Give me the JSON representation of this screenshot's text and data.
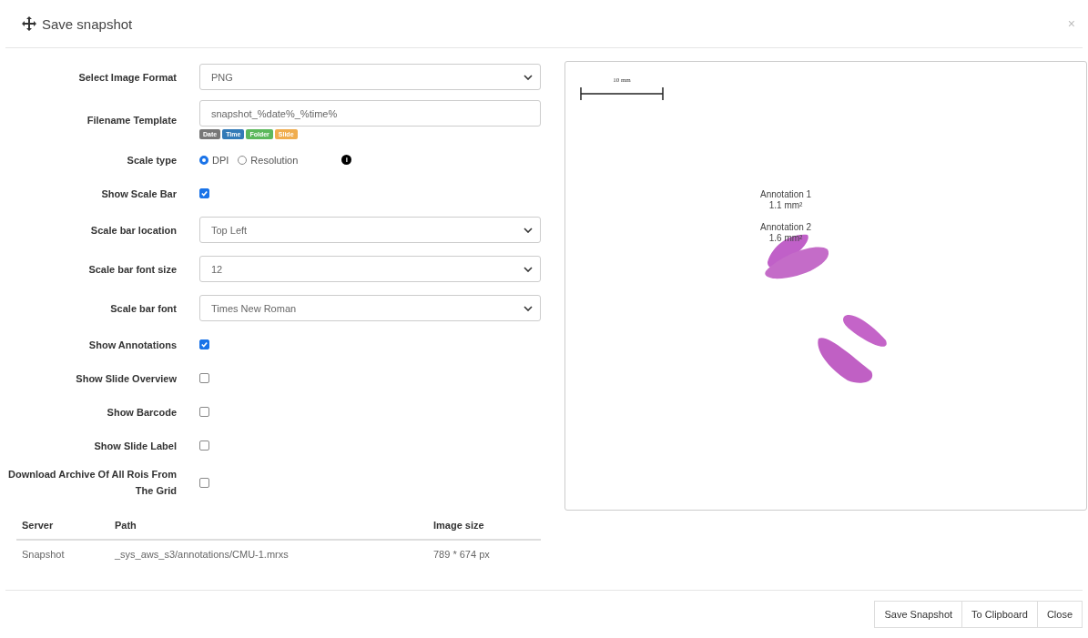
{
  "dialog": {
    "title": "Save snapshot",
    "close": "×"
  },
  "fields": [
    {
      "kind": "select",
      "label": "Select Image Format",
      "value": "PNG"
    },
    {
      "kind": "text",
      "label": "Filename Template",
      "value": "snapshot_%date%_%time%",
      "tags": [
        {
          "label": "Date",
          "color": "#777777"
        },
        {
          "label": "Time",
          "color": "#337ab7"
        },
        {
          "label": "Folder",
          "color": "#5cb85c"
        },
        {
          "label": "Slide",
          "color": "#f0ad4e"
        }
      ]
    },
    {
      "kind": "radio",
      "label": "Scale type",
      "options": [
        {
          "label": "DPI",
          "selected": true
        },
        {
          "label": "Resolution",
          "selected": false
        }
      ],
      "info": "i"
    },
    {
      "kind": "checkbox",
      "label": "Show Scale Bar",
      "checked": true
    },
    {
      "kind": "select",
      "label": "Scale bar location",
      "value": "Top Left"
    },
    {
      "kind": "select",
      "label": "Scale bar font size",
      "value": "12"
    },
    {
      "kind": "select",
      "label": "Scale bar font",
      "value": "Times New Roman"
    },
    {
      "kind": "checkbox",
      "label": "Show Annotations",
      "checked": true
    },
    {
      "kind": "checkbox",
      "label": "Show Slide Overview",
      "checked": false
    },
    {
      "kind": "checkbox",
      "label": "Show Barcode",
      "checked": false
    },
    {
      "kind": "checkbox",
      "label": "Show Slide Label",
      "checked": false
    },
    {
      "kind": "checkbox",
      "label": "Download Archive Of All Rois From The Grid",
      "checked": false
    }
  ],
  "table": {
    "columns": [
      "Server",
      "Path",
      "Image size"
    ],
    "rows": [
      [
        "Snapshot",
        "_sys_aws_s3/annotations/CMU-1.mrxs",
        "789 * 674 px"
      ]
    ]
  },
  "preview": {
    "scale_label": "10 mm",
    "annotations": [
      {
        "name": "Annotation 1",
        "area": "1.1 mm²"
      },
      {
        "name": "Annotation 2",
        "area": "1.6 mm²"
      }
    ]
  },
  "buttons": [
    "Save Snapshot",
    "To Clipboard",
    "Close"
  ]
}
